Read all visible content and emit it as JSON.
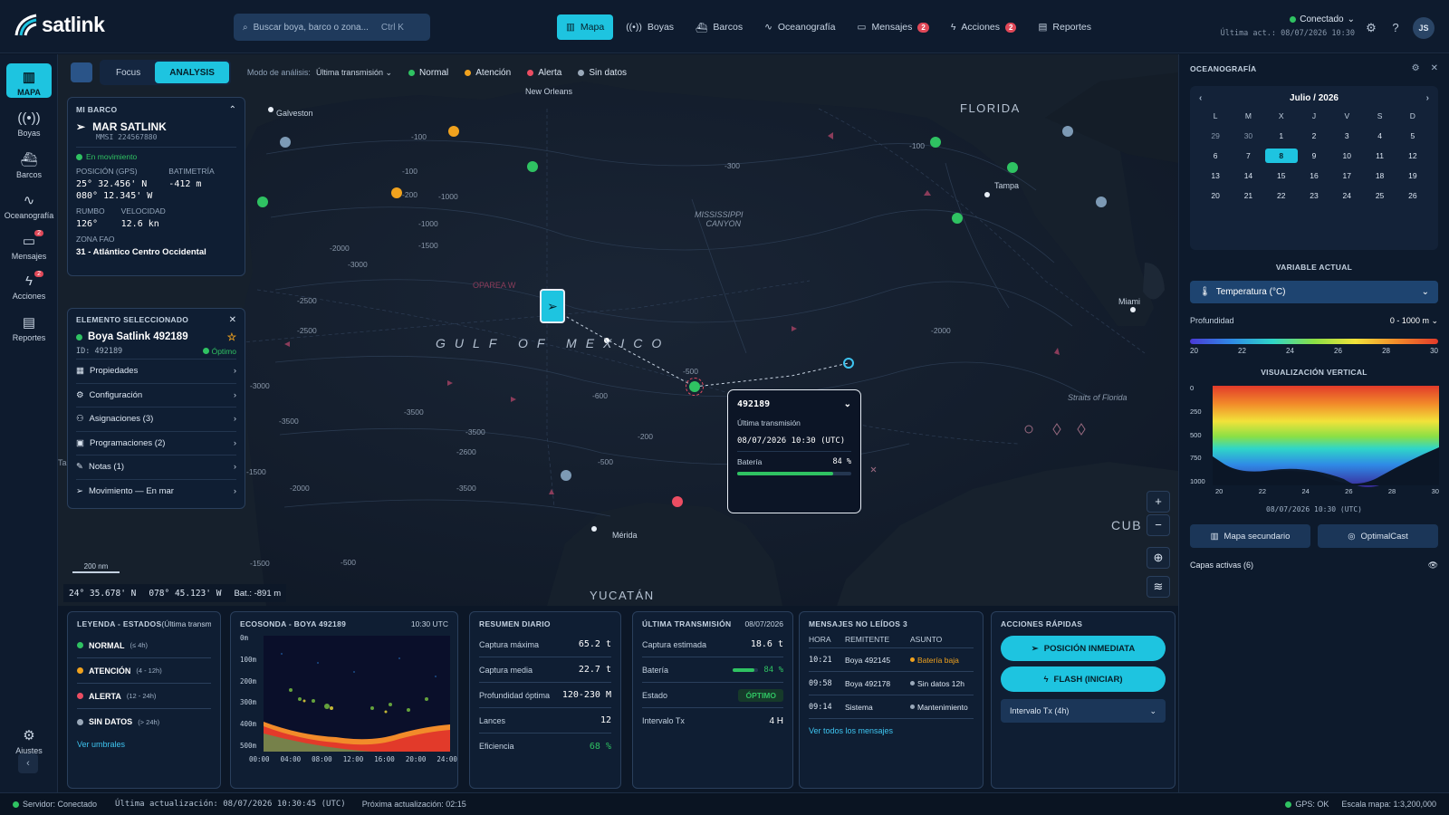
{
  "app": {
    "logo": "satlink"
  },
  "search": {
    "placeholder": "Buscar boya, barco o zona...",
    "shortcut": "Ctrl K"
  },
  "nav": [
    {
      "label": "Mapa",
      "active": true
    },
    {
      "label": "Boyas"
    },
    {
      "label": "Barcos"
    },
    {
      "label": "Oceanografía"
    },
    {
      "label": "Mensajes",
      "badge": "2"
    },
    {
      "label": "Acciones",
      "badge": "2"
    },
    {
      "label": "Reportes"
    }
  ],
  "connection": {
    "status": "Conectado",
    "last_update": "Última act.: 08/07/2026 10:30"
  },
  "user": {
    "initials": "JS"
  },
  "sidebar": [
    {
      "label": "MAPA"
    },
    {
      "label": "Boyas"
    },
    {
      "label": "Barcos"
    },
    {
      "label": "Oceanografía"
    },
    {
      "label": "Mensajes",
      "badge": "2"
    },
    {
      "label": "Acciones",
      "badge": "2"
    },
    {
      "label": "Reportes"
    },
    {
      "label": "Ajustes"
    }
  ],
  "mode": {
    "focus": "Focus",
    "analysis": "ANALYSIS",
    "label": "Modo de análisis:",
    "value": "Última transmisión"
  },
  "legend_states": [
    {
      "label": "Normal",
      "color": "#2fc262"
    },
    {
      "label": "Atención",
      "color": "#f0a21e"
    },
    {
      "label": "Alerta",
      "color": "#ec4d62"
    },
    {
      "label": "Sin datos",
      "color": "#9aa9ba"
    }
  ],
  "map_labels": {
    "gulf": "GULF OF MEXICO",
    "florida": "FLORIDA",
    "canyon1": "MISSISSIPPI",
    "canyon2": "CANYON",
    "yucatan": "YUCATÁN",
    "cuba": "CUB",
    "galveston": "Galveston",
    "new_orleans": "New Orleans",
    "tampa": "Tampa",
    "miami": "Miami",
    "merida": "Mérida",
    "straits": "Straits of Florida",
    "oparea": "OPAREA W",
    "ta": "Ta"
  },
  "depths": [
    "-100",
    "-100",
    "-200",
    "-1000",
    "-1500",
    "-2000",
    "-2500",
    "-3000",
    "-3500",
    "-2500",
    "-3000",
    "-3500",
    "-1500",
    "-2000",
    "-3500",
    "-500",
    "-600",
    "-500",
    "-200",
    "-3500",
    "-2600",
    "-1000",
    "-500",
    "-1500",
    "-100",
    "-300",
    "-2000"
  ],
  "my_boat": {
    "title": "MI BARCO",
    "name": "MAR SATLINK",
    "mmsi": "MMSI 224567880",
    "status": "En movimiento",
    "pos_label": "POSICIÓN (GPS)",
    "lat": "25° 32.456' N",
    "lon": "080° 12.345' W",
    "bat_label": "BATIMETRÍA",
    "bat": "-412 m",
    "heading_label": "RUMBO",
    "heading": "126°",
    "speed_label": "VELOCIDAD",
    "speed": "12.6 kn",
    "fao_label": "ZONA FAO",
    "fao": "31 - Atlántico Centro Occidental"
  },
  "selected": {
    "title": "ELEMENTO SELECCIONADO",
    "name": "Boya Satlink 492189",
    "id": "ID: 492189",
    "state": "Óptimo",
    "menu": [
      "Propiedades",
      "Configuración",
      "Asignaciones (3)",
      "Programaciones (2)",
      "Notas (1)",
      "Movimiento — En mar"
    ]
  },
  "popup": {
    "id": "492189",
    "label": "Última transmisión",
    "time": "08/07/2026 10:30 (UTC)",
    "battery_label": "Batería",
    "battery": "84 %",
    "battery_fraction": 0.84
  },
  "map_footer": {
    "lat": "24° 35.678' N",
    "lon": "078° 45.123' W",
    "bat": "Bat.: -891 m",
    "scale": "200 nm"
  },
  "ocean": {
    "title": "OCEANOGRAFÍA",
    "month": "Julio / 2026",
    "weekdays": [
      "L",
      "M",
      "X",
      "J",
      "V",
      "S",
      "D"
    ],
    "days": [
      "29",
      "30",
      "1",
      "2",
      "3",
      "4",
      "5",
      "6",
      "7",
      "8",
      "9",
      "10",
      "11",
      "12",
      "13",
      "14",
      "15",
      "16",
      "17",
      "18",
      "19",
      "20",
      "21",
      "22",
      "23",
      "24",
      "25",
      "26"
    ],
    "selected_day": "8",
    "var_title": "VARIABLE ACTUAL",
    "variable": "Temperatura (°C)",
    "depth_label": "Profundidad",
    "depth_value": "0 - 1000 m",
    "scale_ticks": [
      "20",
      "22",
      "24",
      "26",
      "28",
      "30"
    ],
    "vert_title": "VISUALIZACIÓN VERTICAL",
    "vert_y": [
      "0",
      "250",
      "500",
      "750",
      "1000"
    ],
    "vert_x": [
      "20",
      "22",
      "24",
      "26",
      "28",
      "30"
    ],
    "vert_time": "08/07/2026 10:30 (UTC)",
    "btn_secondary": "Mapa secundario",
    "btn_optimal": "OptimalCast",
    "layers": "Capas activas (6)"
  },
  "legend_panel": {
    "title": "LEYENDA - ESTADOS",
    "subtitle": "(Última transm",
    "items": [
      {
        "label": "NORMAL",
        "range": "(≤ 4h)",
        "color": "#2fc262"
      },
      {
        "label": "ATENCIÓN",
        "range": "(4 - 12h)",
        "color": "#f0a21e"
      },
      {
        "label": "ALERTA",
        "range": "(12 - 24h)",
        "color": "#ec4d62"
      },
      {
        "label": "SIN DATOS",
        "range": "(> 24h)",
        "color": "#9aa9ba"
      }
    ],
    "link": "Ver umbrales"
  },
  "echo": {
    "title": "ECOSONDA - BOYA 492189",
    "time": "10:30 UTC",
    "y": [
      "0m",
      "100m",
      "200m",
      "300m",
      "400m",
      "500m"
    ],
    "x": [
      "00:00",
      "04:00",
      "08:00",
      "12:00",
      "16:00",
      "20:00",
      "24:00"
    ]
  },
  "daily": {
    "title": "RESUMEN DIARIO",
    "rows": [
      {
        "k": "Captura máxima",
        "v": "65.2 t"
      },
      {
        "k": "Captura media",
        "v": "22.7 t"
      },
      {
        "k": "Profundidad óptima",
        "v": "120-230 M"
      },
      {
        "k": "Lances",
        "v": "12"
      },
      {
        "k": "Eficiencia",
        "v": "68 %"
      }
    ]
  },
  "lasttx": {
    "title": "ÚLTIMA TRANSMISIÓN",
    "date": "08/07/2026",
    "rows": [
      {
        "k": "Captura estimada",
        "v": "18.6 t"
      },
      {
        "k": "Batería",
        "v": "84 %"
      },
      {
        "k": "Estado",
        "v": "ÓPTIMO"
      },
      {
        "k": "Intervalo Tx",
        "v": "4 H"
      }
    ],
    "battery_fraction": 0.84
  },
  "messages": {
    "title": "MENSAJES NO LEÍDOS 3",
    "cols": [
      "HORA",
      "REMITENTE",
      "ASUNTO"
    ],
    "rows": [
      {
        "h": "10:21",
        "from": "Boya 492145",
        "subj": "Batería baja",
        "color": "#f0a21e"
      },
      {
        "h": "09:58",
        "from": "Boya 492178",
        "subj": "Sin datos 12h",
        "color": "#9aa9ba"
      },
      {
        "h": "09:14",
        "from": "Sistema",
        "subj": "Mantenimiento",
        "color": "#9aa9ba"
      }
    ],
    "link": "Ver todos los mensajes"
  },
  "quick": {
    "title": "ACCIONES RÁPIDAS",
    "btn1": "POSICIÓN INMEDIATA",
    "btn2": "FLASH (INICIAR)",
    "select": "Intervalo Tx (4h)"
  },
  "status": {
    "server": "Servidor: Conectado",
    "last": "Última actualización: 08/07/2026 10:30:45 (UTC)",
    "next": "Próxima actualización: 02:15",
    "gps": "GPS: OK",
    "scale": "Escala mapa: 1:3,200,000"
  }
}
